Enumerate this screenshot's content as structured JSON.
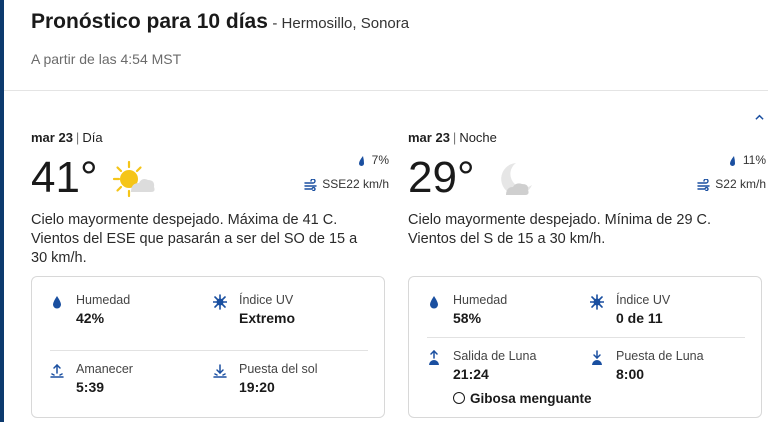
{
  "header": {
    "title": "Pronóstico para 10 días",
    "location": "- Hermosillo, Sonora",
    "updated": "A partir de las 4:54 MST"
  },
  "day": {
    "date": "mar 23",
    "period": "Día",
    "temp": "41°",
    "icon": "sun-partly-cloudy-icon",
    "precip": "7%",
    "wind": "SSE22 km/h",
    "description": "Cielo mayormente despejado. Máxima de 41 C. Vientos del ESE que pasarán a ser del SO de 15 a 30 km/h.",
    "details": {
      "humidity_label": "Humedad",
      "humidity": "42%",
      "uv_label": "Índice UV",
      "uv": "Extremo",
      "sunrise_label": "Amanecer",
      "sunrise": "5:39",
      "sunset_label": "Puesta del sol",
      "sunset": "19:20"
    }
  },
  "night": {
    "date": "mar 23",
    "period": "Noche",
    "temp": "29°",
    "icon": "moon-cloudy-icon",
    "precip": "11%",
    "wind": "S22 km/h",
    "description": "Cielo mayormente despejado. Mínima de 29 C. Vientos del S de 15 a 30 km/h.",
    "details": {
      "humidity_label": "Humedad",
      "humidity": "58%",
      "uv_label": "Índice UV",
      "uv": "0 de 11",
      "moonrise_label": "Salida de Luna",
      "moonrise": "21:24",
      "moonset_label": "Puesta de Luna",
      "moonset": "8:00",
      "moon_phase": "Gibosa menguante"
    }
  },
  "colors": {
    "accent": "#1a4fa0",
    "sun": "#f5c518",
    "cloud": "#d9d9d9",
    "edge": "#0d3a6e"
  }
}
